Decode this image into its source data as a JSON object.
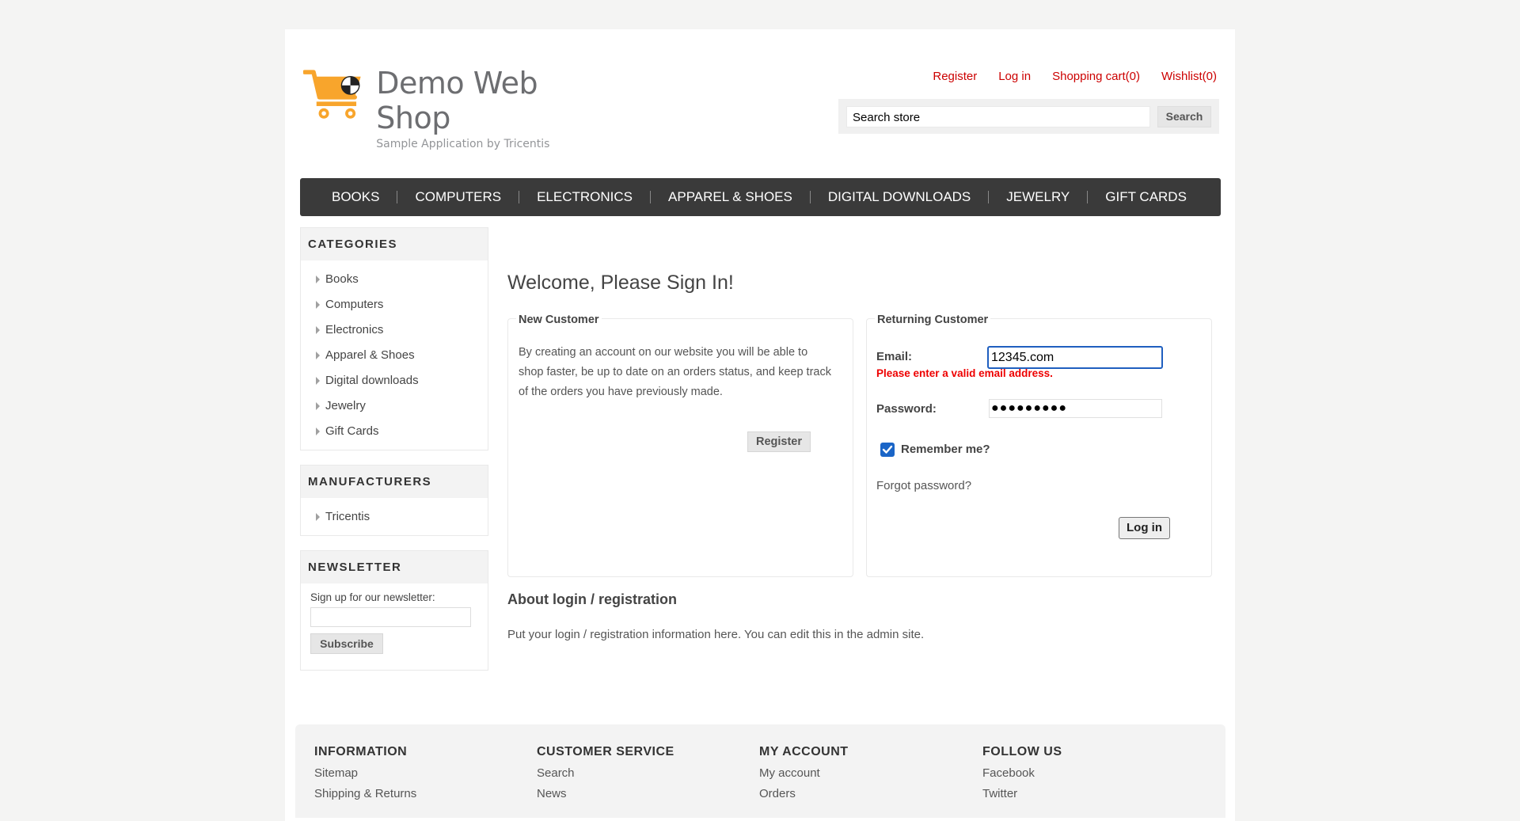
{
  "header": {
    "logo_title": "Demo Web Shop",
    "logo_subtitle": "Sample Application by Tricentis",
    "links": {
      "register": "Register",
      "login": "Log in",
      "cart": "Shopping cart(0)",
      "wishlist": "Wishlist(0)"
    },
    "search": {
      "value": "Search store",
      "button": "Search"
    }
  },
  "top_menu": [
    "BOOKS",
    "COMPUTERS",
    "ELECTRONICS",
    "APPAREL & SHOES",
    "DIGITAL DOWNLOADS",
    "JEWELRY",
    "GIFT CARDS"
  ],
  "categories": {
    "title": "CATEGORIES",
    "items": [
      "Books",
      "Computers",
      "Electronics",
      "Apparel & Shoes",
      "Digital downloads",
      "Jewelry",
      "Gift Cards"
    ]
  },
  "manufacturers": {
    "title": "MANUFACTURERS",
    "items": [
      "Tricentis"
    ]
  },
  "newsletter": {
    "title": "NEWSLETTER",
    "label": "Sign up for our newsletter:",
    "button": "Subscribe"
  },
  "main": {
    "page_title": "Welcome, Please Sign In!",
    "new_customer": {
      "legend": "New Customer",
      "text": "By creating an account on our website you will be able to shop faster, be up to date on an orders status, and keep track of the orders you have previously made.",
      "button": "Register"
    },
    "returning_customer": {
      "legend": "Returning Customer",
      "email_label": "Email:",
      "email_value": "12345.com",
      "email_error": "Please enter a valid email address.",
      "password_label": "Password:",
      "password_mask": "●●●●●●●●●",
      "remember_label": "Remember me?",
      "remember_checked": true,
      "forgot": "Forgot password?",
      "button": "Log in"
    },
    "about_title": "About login / registration",
    "about_text": "Put your login / registration information here. You can edit this in the admin site."
  },
  "footer": {
    "columns": [
      {
        "title": "INFORMATION",
        "links": [
          "Sitemap",
          "Shipping & Returns"
        ]
      },
      {
        "title": "CUSTOMER SERVICE",
        "links": [
          "Search",
          "News"
        ]
      },
      {
        "title": "MY ACCOUNT",
        "links": [
          "My account",
          "Orders"
        ]
      },
      {
        "title": "FOLLOW US",
        "links": [
          "Facebook",
          "Twitter"
        ]
      }
    ]
  },
  "colors": {
    "link_red": "#cc0000",
    "menu_bg": "#3a3a3a",
    "error_red": "#ee0000",
    "focus_blue": "#1f5fbf",
    "logo_orange": "#f8a52c"
  }
}
